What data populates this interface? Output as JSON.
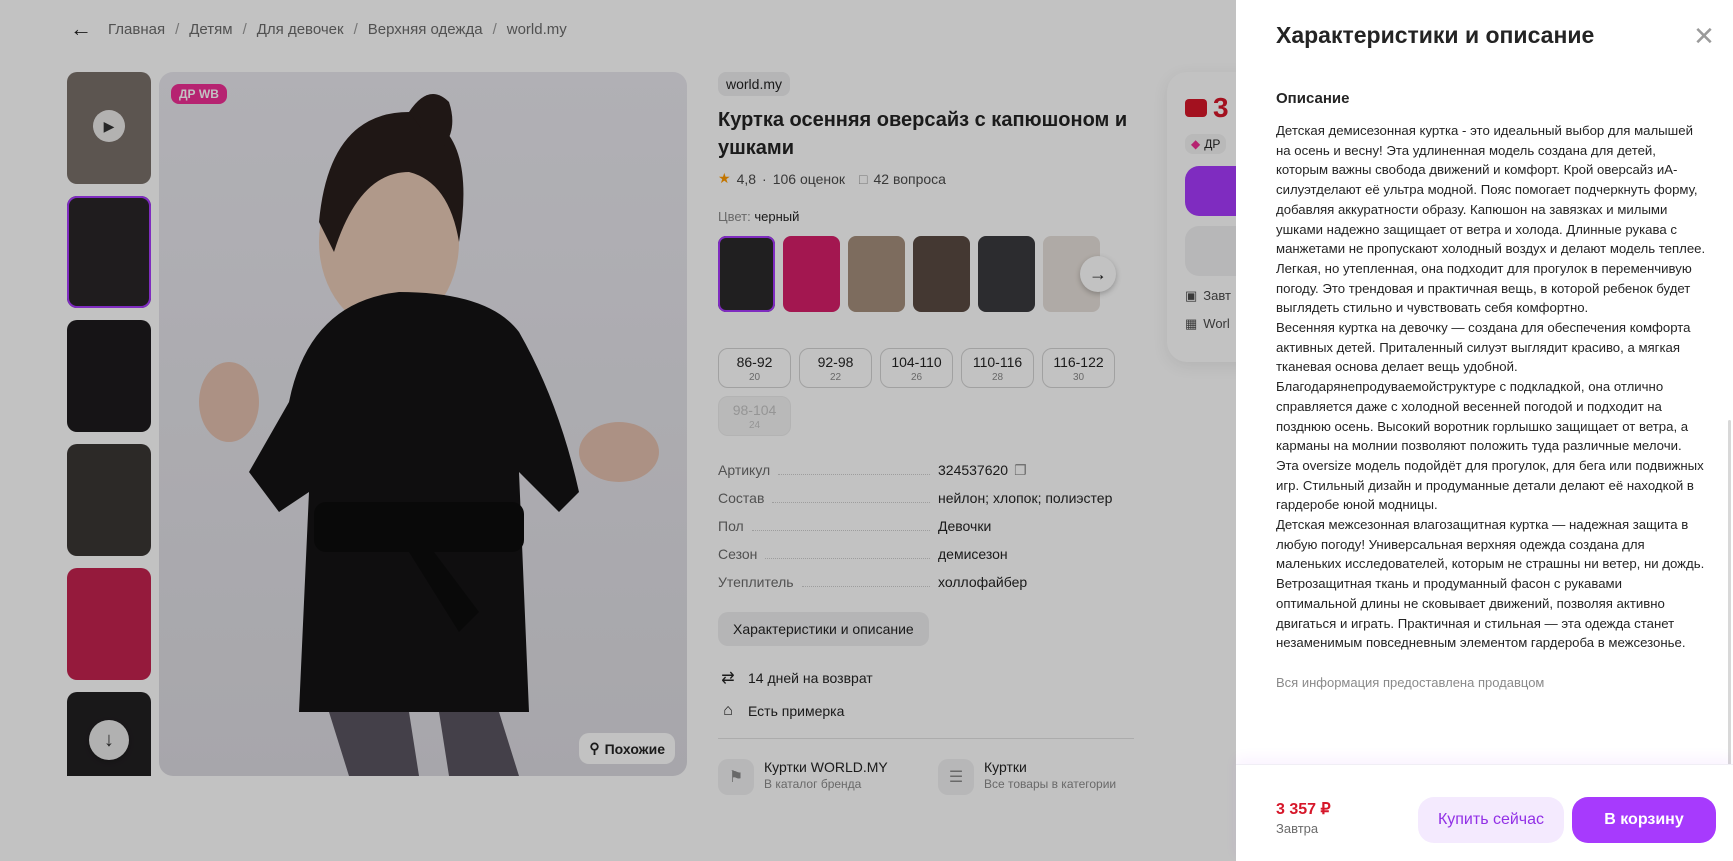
{
  "breadcrumbs": [
    "Главная",
    "Детям",
    "Для девочек",
    "Верхняя одежда",
    "world.my"
  ],
  "gallery": {
    "badge": "ДР WB",
    "similar_label": "Похожие",
    "thumb_colors": [
      "#7a706a",
      "#2a2628",
      "#1d1b1d",
      "#3a3634",
      "#c4234f",
      "#222022"
    ],
    "main_color": "#e4e3e9"
  },
  "product": {
    "brand": "world.my",
    "title": "Куртка осенняя оверсайз с капюшоном и ушками",
    "rating": "4,8",
    "rating_sep": "·",
    "reviews": "106 оценок",
    "questions": "42 вопроса",
    "color_label": "Цвет:",
    "color_value": "черный",
    "swatch_colors": [
      "#2b292b",
      "#d61f6a",
      "#a58f7c",
      "#5a4a42",
      "#3b3a3e",
      "#e7e0da"
    ],
    "sizes": [
      {
        "size": "86-92",
        "ru": "20",
        "disabled": false
      },
      {
        "size": "92-98",
        "ru": "22",
        "disabled": false
      },
      {
        "size": "104-110",
        "ru": "26",
        "disabled": false
      },
      {
        "size": "110-116",
        "ru": "28",
        "disabled": false
      },
      {
        "size": "116-122",
        "ru": "30",
        "disabled": false
      },
      {
        "size": "98-104",
        "ru": "24",
        "disabled": true
      }
    ],
    "specs": [
      {
        "key": "Артикул",
        "value": "324537620"
      },
      {
        "key": "Состав",
        "value": "нейлон; хлопок; полиэстер"
      },
      {
        "key": "Пол",
        "value": "Девочки"
      },
      {
        "key": "Сезон",
        "value": "демисезон"
      },
      {
        "key": "Утеплитель",
        "value": "холлофайбер"
      }
    ],
    "specs_button": "Характеристики и описание",
    "perks": [
      "14 дней на возврат",
      "Есть примерка"
    ],
    "links": [
      {
        "title": "Куртки WORLD.MY",
        "sub": "В каталог бренда"
      },
      {
        "title": "Куртки",
        "sub": "Все товары в категории"
      }
    ]
  },
  "buy_card": {
    "price_partial": "3",
    "badge_partial": "ДР",
    "line1": "Завт",
    "line2": "Worl"
  },
  "drawer": {
    "title": "Характеристики и описание",
    "description_heading": "Описание",
    "description": "Детская демисезонная куртка - это идеальный выбор для малышей на осень и весну! Эта удлиненная модель создана для детей, которым важны свобода движений и комфорт. Крой оверсайз иА-силуэтделают её ультра модной. Пояс помогает подчеркнуть форму, добавляя аккуратности образу. Капюшон на завязках и милыми ушками надежно защищает от ветра и холода. Длинные рукава с манжетами не пропускают холодный воздух и делают модель теплее. Легкая, но утепленная, она подходит для прогулок в переменчивую погоду. Это трендовая и практичная вещь, в которой ребенок будет выглядеть стильно и чувствовать себя комфортно.\nВесенняя куртка на девочку — создана для обеспечения комфорта активных детей. Приталенный силуэт выглядит красиво, а мягкая тканевая основа делает вещь удобной. Благодарянепродуваемойструктуре с подкладкой, она отлично справляется даже с холодной весенней погодой и подходит на позднюю осень. Высокий воротник горлышко защищает от ветра, а карманы на молнии позволяют положить туда различные мелочи. Эта oversize модель подойдёт для прогулок, для бега или подвижных игр. Стильный дизайн и продуманные детали делают её находкой в гардеробе юной модницы.\nДетская межсезонная влагозащитная куртка — надежная защита в любую погоду! Универсальная верхняя одежда создана для маленьких исследователей, которым не страшны ни ветер, ни дождь. Ветрозащитная ткань и продуманный фасон с рукавами оптимальной длины не сковывает движений, позволяя активно двигаться и играть. Практичная и стильная — эта одежда станет незаменимым повседневным элементом гардероба в межсезонье.",
    "info_note": "Вся информация предоставлена продавцом",
    "footer": {
      "price": "3 357 ₽",
      "when": "Завтра",
      "buy_now": "Купить сейчас",
      "to_cart": "В корзину"
    }
  },
  "colors": {
    "accent": "#a73afd",
    "price": "#d6172a",
    "badge": "#ef2f95"
  }
}
